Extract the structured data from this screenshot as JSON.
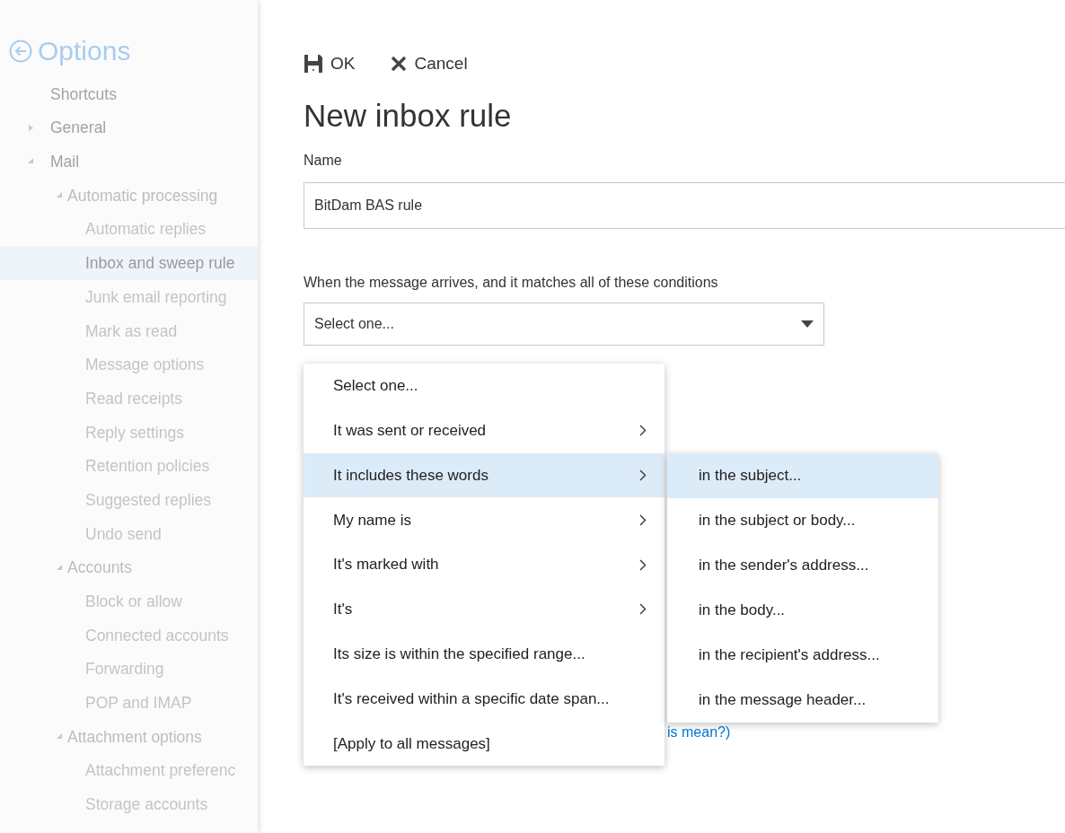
{
  "sidebar": {
    "title": "Options",
    "items": [
      {
        "label": "Shortcuts",
        "selected": false
      },
      {
        "label": "General",
        "selected": false,
        "expanded": false
      },
      {
        "label": "Mail",
        "selected": false,
        "expanded": true,
        "children": [
          {
            "label": "Automatic processing",
            "selected": false,
            "expanded": true,
            "children": [
              {
                "label": "Automatic replies",
                "selected": false
              },
              {
                "label": "Inbox and sweep rule",
                "selected": true
              },
              {
                "label": "Junk email reporting",
                "selected": false
              },
              {
                "label": "Mark as read",
                "selected": false
              },
              {
                "label": "Message options",
                "selected": false
              },
              {
                "label": "Read receipts",
                "selected": false
              },
              {
                "label": "Reply settings",
                "selected": false
              },
              {
                "label": "Retention policies",
                "selected": false
              },
              {
                "label": "Suggested replies",
                "selected": false
              },
              {
                "label": "Undo send",
                "selected": false
              }
            ]
          },
          {
            "label": "Accounts",
            "selected": false,
            "expanded": true,
            "children": [
              {
                "label": "Block or allow",
                "selected": false
              },
              {
                "label": "Connected accounts",
                "selected": false
              },
              {
                "label": "Forwarding",
                "selected": false
              },
              {
                "label": "POP and IMAP",
                "selected": false
              }
            ]
          },
          {
            "label": "Attachment options",
            "selected": false,
            "expanded": true,
            "children": [
              {
                "label": "Attachment preferenc",
                "selected": false
              },
              {
                "label": "Storage accounts",
                "selected": false
              }
            ]
          }
        ]
      }
    ]
  },
  "toolbar": [
    {
      "kind": "save",
      "label": "OK"
    },
    {
      "kind": "cancel",
      "label": "Cancel"
    }
  ],
  "form": {
    "title": "New inbox rule",
    "name_label": "Name",
    "name_value": "BitDam BAS rule",
    "condition_label": "When the message arrives, and it matches all of these conditions",
    "condition_select": "Select one...",
    "help_link": "is mean?)"
  },
  "dropdown": [
    {
      "label": "Select one...",
      "has_submenu": false,
      "selected": false
    },
    {
      "label": "It was sent or received",
      "has_submenu": true,
      "selected": false
    },
    {
      "label": "It includes these words",
      "has_submenu": true,
      "selected": true
    },
    {
      "label": "My name is",
      "has_submenu": true,
      "selected": false
    },
    {
      "label": "It's marked with",
      "has_submenu": true,
      "selected": false
    },
    {
      "label": "It's",
      "has_submenu": true,
      "selected": false
    },
    {
      "label": "Its size is within the specified range...",
      "has_submenu": false,
      "selected": false
    },
    {
      "label": "It's received within a specific date span...",
      "has_submenu": false,
      "selected": false
    },
    {
      "label": "[Apply to all messages]",
      "has_submenu": false,
      "selected": false
    }
  ],
  "submenu": [
    {
      "label": "in the subject...",
      "selected": true
    },
    {
      "label": "in the subject or body...",
      "selected": false
    },
    {
      "label": "in the sender's address...",
      "selected": false
    },
    {
      "label": "in the body...",
      "selected": false
    },
    {
      "label": "in the recipient's address...",
      "selected": false
    },
    {
      "label": "in the message header...",
      "selected": false
    }
  ]
}
